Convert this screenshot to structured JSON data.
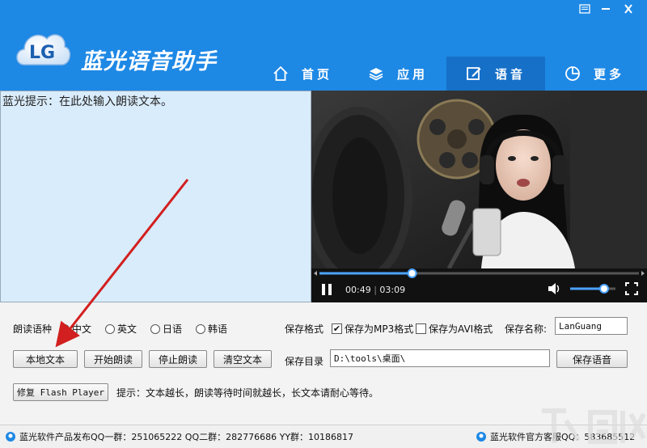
{
  "app": {
    "logo_text": "LG",
    "title": "蓝光语音助手"
  },
  "nav": {
    "items": [
      {
        "label": "首页",
        "icon": "home-icon"
      },
      {
        "label": "应用",
        "icon": "layers-icon"
      },
      {
        "label": "语音",
        "icon": "edit-icon",
        "active": true
      },
      {
        "label": "更多",
        "icon": "pie-chart-icon"
      }
    ]
  },
  "textarea": {
    "value": "蓝光提示：在此处输入朗读文本。"
  },
  "player": {
    "current_time": "00:49",
    "total_time": "03:09",
    "progress": 0.29,
    "volume": 0.75
  },
  "language": {
    "label": "朗读语种",
    "options": [
      "中文",
      "英文",
      "日语",
      "韩语"
    ],
    "selected": "中文"
  },
  "format": {
    "label": "保存格式",
    "mp3_label": "保存为MP3格式",
    "mp3_checked": true,
    "avi_label": "保存为AVI格式",
    "avi_checked": false
  },
  "save_name": {
    "label": "保存名称:",
    "value": "LanGuang"
  },
  "save_dir": {
    "label": "保存目录",
    "value": "D:\\tools\\桌面\\"
  },
  "buttons": {
    "local_text": "本地文本",
    "start_reading": "开始朗读",
    "stop_reading": "停止朗读",
    "clear_text": "清空文本",
    "save_voice": "保存语音",
    "fix_flash": "修复 Flash Player"
  },
  "hint": "提示：文本越长，朗读等待时间就越长，长文本请耐心等待。",
  "status": {
    "left": "蓝光软件产品发布QQ一群：251065222 QQ二群：282776686 YY群：10186817",
    "right": "蓝光软件官方客服QQ：583685512"
  },
  "colors": {
    "header": "#1e88e5",
    "nav_active": "#1670c8",
    "textarea_bg": "#d9ecfb",
    "player_accent": "#4aa3ff",
    "arrow": "#d21f1f"
  }
}
